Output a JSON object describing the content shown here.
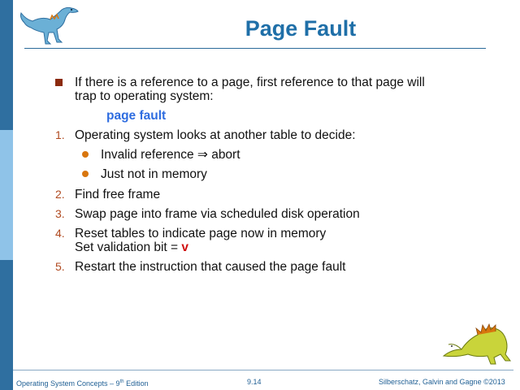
{
  "slide": {
    "title": "Page Fault"
  },
  "intro": {
    "line1": "If there is a reference to a page, first reference to that page will",
    "line2": "trap to operating system:",
    "keyword": "page fault"
  },
  "steps": [
    {
      "number": "1.",
      "text": "Operating system looks at another table to decide:",
      "subitems": [
        "Invalid reference ⇒ abort",
        "Just not in memory"
      ]
    },
    {
      "number": "2.",
      "text": "Find free frame"
    },
    {
      "number": "3.",
      "text": "Swap page into frame via scheduled disk operation"
    },
    {
      "number": "4.",
      "text": "Reset tables to indicate page now in memory",
      "line2_prefix": "Set validation bit = ",
      "line2_value": "v"
    },
    {
      "number": "5.",
      "text": "Restart the instruction that caused the page fault"
    }
  ],
  "footer": {
    "book_prefix": "Operating System Concepts – 9",
    "book_sup": "th",
    "book_suffix": " Edition",
    "page_number": "9.14",
    "copyright": "Silberschatz, Galvin and Gagne ©2013"
  },
  "colors": {
    "title": "#1f6fa8",
    "strip_dark": "#2f6fa0",
    "strip_light": "#8fc3e8",
    "square_bullet": "#8b2a0e",
    "dot_bullet": "#d8760e",
    "keyword_blue": "#2f6de0",
    "keyword_red": "#d01010"
  },
  "icons": {
    "top_logo": "dinosaur-logo-icon",
    "bottom_logo": "dinosaur-logo-icon"
  }
}
